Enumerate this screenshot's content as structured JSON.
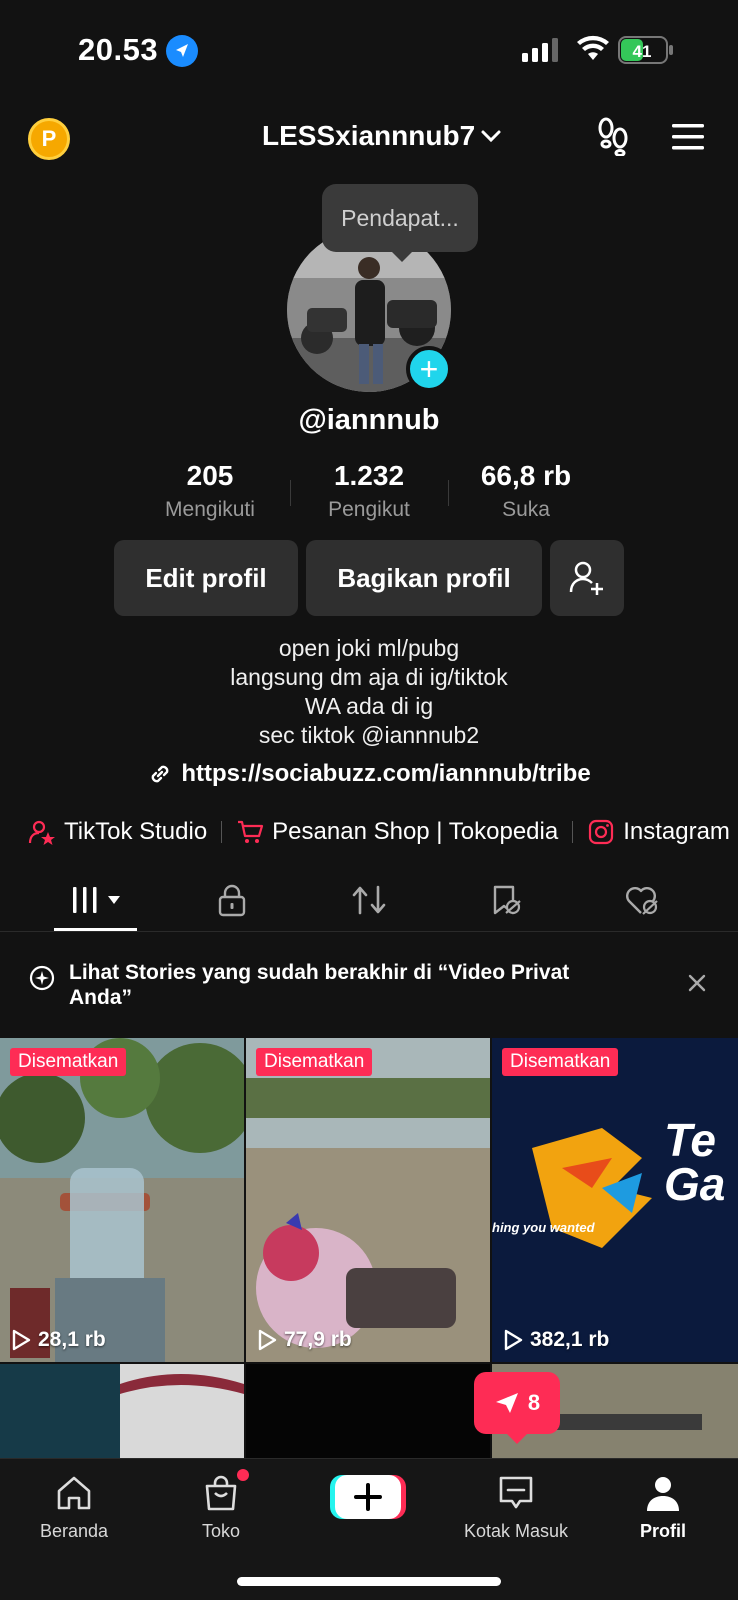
{
  "status_bar": {
    "time": "20.53",
    "battery": "41"
  },
  "header": {
    "username": "LESSxiannnub7",
    "coin_label": "P"
  },
  "profile": {
    "tooltip": "Pendapat...",
    "handle": "@iannnub",
    "stats": [
      {
        "value": "205",
        "label": "Mengikuti"
      },
      {
        "value": "1.232",
        "label": "Pengikut"
      },
      {
        "value": "66,8 rb",
        "label": "Suka"
      }
    ],
    "buttons": {
      "edit": "Edit profil",
      "share": "Bagikan profil"
    },
    "bio": [
      "open joki ml/pubg",
      "langsung dm aja di ig/tiktok",
      "WA ada di ig",
      "sec tiktok @iannnub2"
    ],
    "link": "https://sociabuzz.com/iannnub/tribe",
    "shortcuts": [
      "TikTok Studio",
      "Pesanan Shop | Tokopedia",
      "Instagram"
    ]
  },
  "notice": {
    "text": "Lihat Stories yang sudah berakhir di “Video Privat Anda”"
  },
  "videos": [
    {
      "pinned": "Disematkan",
      "views": "28,1 rb"
    },
    {
      "pinned": "Disematkan",
      "views": "77,9 rb"
    },
    {
      "pinned": "Disematkan",
      "views": "382,1 rb",
      "caption": "hing you wanted",
      "brand": "Te Ga"
    }
  ],
  "inbox_bubble": {
    "count": "8"
  },
  "bottom_nav": {
    "home": "Beranda",
    "shop": "Toko",
    "inbox": "Kotak Masuk",
    "profile": "Profil"
  },
  "colors": {
    "accent": "#fe2c55",
    "cyan": "#20d5ec",
    "background": "#121212"
  }
}
